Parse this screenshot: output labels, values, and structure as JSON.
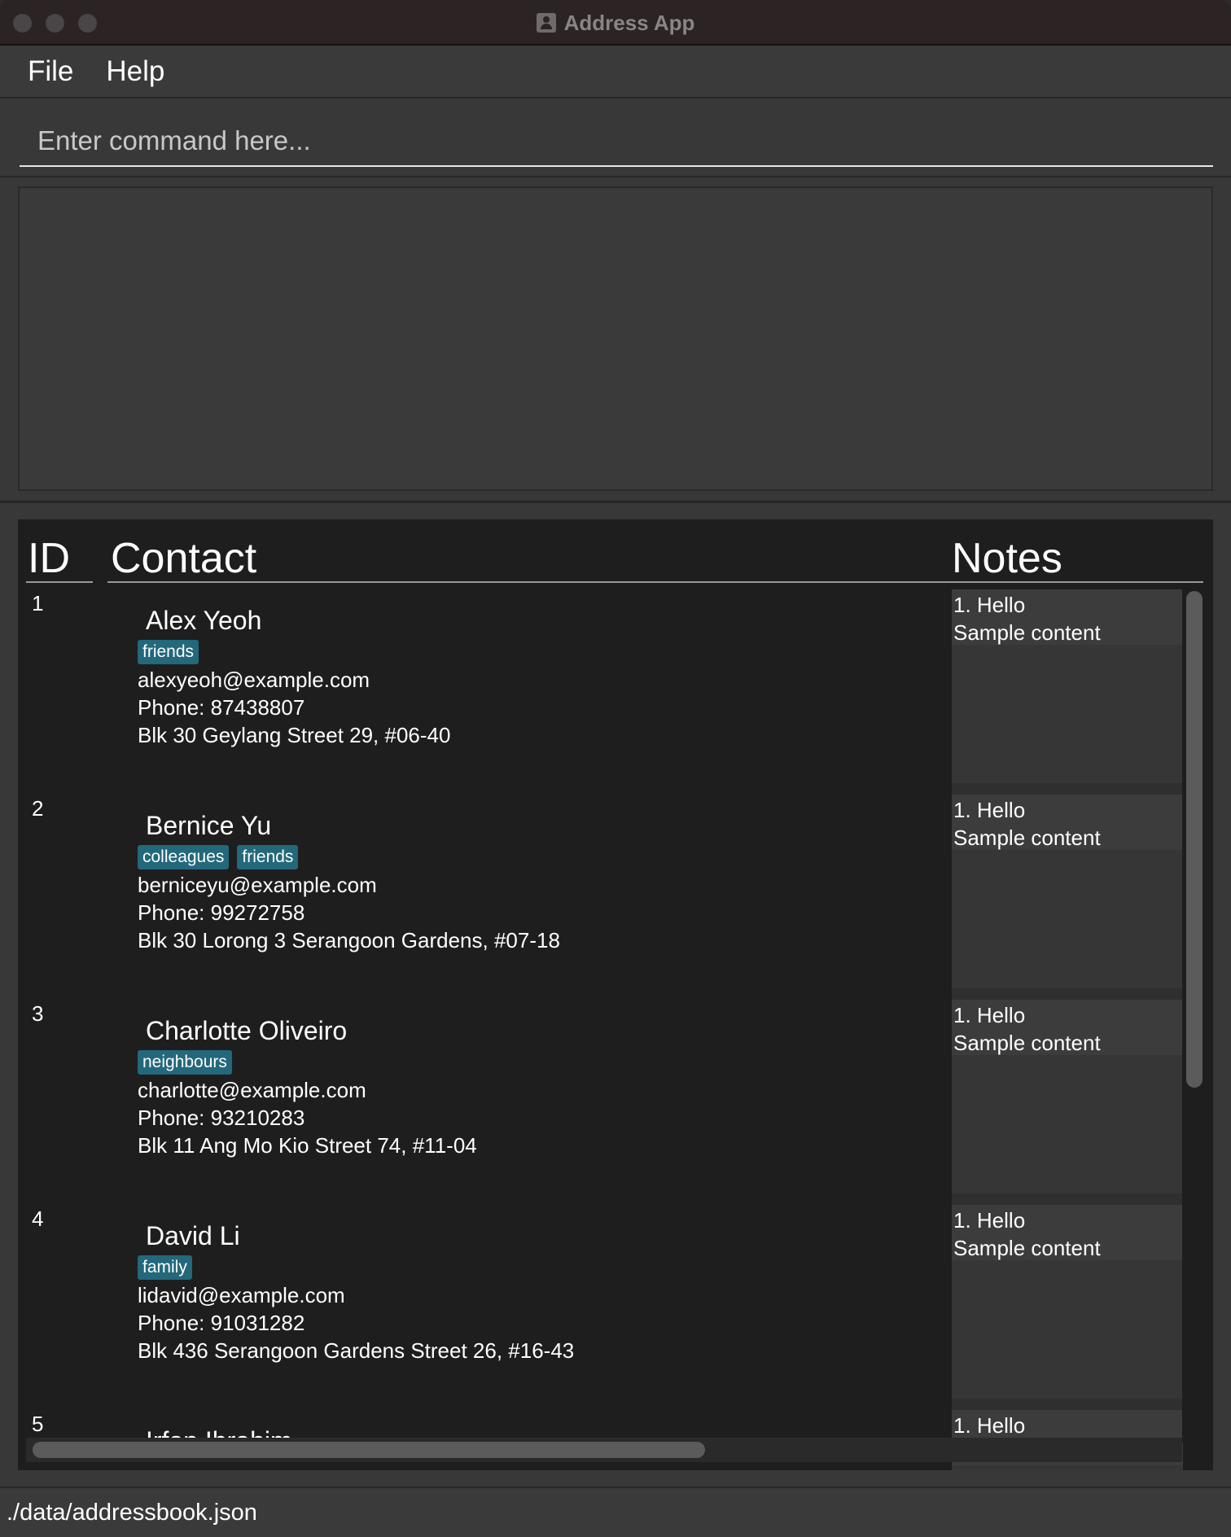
{
  "window": {
    "title": "Address App",
    "icon": "address-book-icon"
  },
  "menu": {
    "items": [
      {
        "label": "File"
      },
      {
        "label": "Help"
      }
    ]
  },
  "command": {
    "placeholder": "Enter command here..."
  },
  "list": {
    "headers": {
      "id": "ID",
      "contact": "Contact",
      "notes": "Notes"
    },
    "rows": [
      {
        "id": "1",
        "name": "Alex Yeoh",
        "tags": [
          "friends"
        ],
        "email": "alexyeoh@example.com",
        "phone": "Phone: 87438807",
        "address": "Blk 30 Geylang Street 29, #06-40",
        "notes": [
          "1. Hello",
          "Sample content"
        ]
      },
      {
        "id": "2",
        "name": "Bernice Yu",
        "tags": [
          "colleagues",
          "friends"
        ],
        "email": "berniceyu@example.com",
        "phone": "Phone: 99272758",
        "address": "Blk 30 Lorong 3 Serangoon Gardens, #07-18",
        "notes": [
          "1. Hello",
          "Sample content"
        ]
      },
      {
        "id": "3",
        "name": "Charlotte Oliveiro",
        "tags": [
          "neighbours"
        ],
        "email": "charlotte@example.com",
        "phone": "Phone: 93210283",
        "address": "Blk 11 Ang Mo Kio Street 74, #11-04",
        "notes": [
          "1. Hello",
          "Sample content"
        ]
      },
      {
        "id": "4",
        "name": "David Li",
        "tags": [
          "family"
        ],
        "email": "lidavid@example.com",
        "phone": "Phone: 91031282",
        "address": "Blk 436 Serangoon Gardens Street 26, #16-43",
        "notes": [
          "1. Hello",
          "Sample content"
        ]
      },
      {
        "id": "5",
        "name": "Irfan Ibrahim",
        "tags": [],
        "email": "",
        "phone": "",
        "address": "",
        "notes": [
          "1. Hello"
        ]
      }
    ]
  },
  "status": {
    "path": "./data/addressbook.json"
  },
  "colors": {
    "tag_bg": "#23687b",
    "panel_bg": "#1e1e1f",
    "chrome_bg": "#3a3a3a"
  }
}
